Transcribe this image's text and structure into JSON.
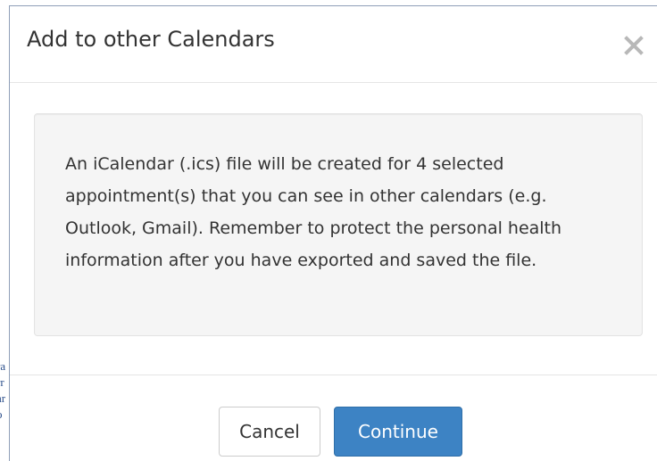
{
  "background_page": {
    "fragments": [
      "ra",
      "rr",
      "ar",
      "o"
    ]
  },
  "dialog": {
    "title": "Add to other Calendars",
    "close_icon": "close-icon",
    "message": "An iCalendar (.ics) file will be created for 4 selected appointment(s) that you can see in other calendars (e.g. Outlook, Gmail). Remember to protect the personal health information after you have exported and saved the file.",
    "buttons": {
      "cancel_label": "Cancel",
      "continue_label": "Continue"
    }
  },
  "colors": {
    "primary_button": "#3d83c4",
    "well_background": "#f5f5f5",
    "text": "#333333"
  }
}
